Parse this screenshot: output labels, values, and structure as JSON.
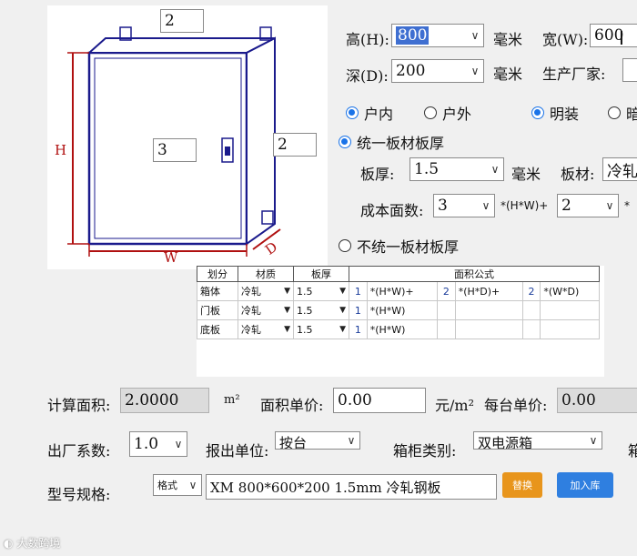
{
  "drawing": {
    "top_value": "2",
    "front_value": "3",
    "side_value": "2",
    "label_h": "H",
    "label_w": "W",
    "label_d": "D"
  },
  "dimensions": {
    "height_label": "高(H):",
    "height_value": "800",
    "height_unit": "毫米",
    "width_label": "宽(W):",
    "width_value": "600",
    "depth_label": "深(D):",
    "depth_value": "200",
    "depth_unit": "毫米",
    "manufacturer_label": "生产厂家:"
  },
  "options": {
    "indoor": "户内",
    "outdoor": "户外",
    "surface": "明装",
    "flush": "暗",
    "uniform": "统一板材板厚",
    "non_uniform": "不统一板材板厚",
    "indoor_selected": true,
    "surface_selected": true,
    "uniform_selected": true
  },
  "uniform": {
    "thickness_label": "板厚:",
    "thickness_value": "1.5",
    "thickness_unit": "毫米",
    "material_label": "板材:",
    "material_value": "冷轧",
    "cost_label": "成本面数:",
    "cost_a": "3",
    "cost_op1": "*(H*W)+",
    "cost_b": "2",
    "cost_op2": "*"
  },
  "table": {
    "headers": [
      "划分",
      "材质",
      "板厚",
      "面积公式"
    ],
    "rows": [
      {
        "part": "箱体",
        "material": "冷轧",
        "thickness": "1.5",
        "c1": "1",
        "f1": "*(H*W)+",
        "c2": "2",
        "f2": "*(H*D)+",
        "c3": "2",
        "f3": "*(W*D)"
      },
      {
        "part": "门板",
        "material": "冷轧",
        "thickness": "1.5",
        "c1": "1",
        "f1": "*(H*W)",
        "c2": "",
        "f2": "",
        "c3": "",
        "f3": ""
      },
      {
        "part": "底板",
        "material": "冷轧",
        "thickness": "1.5",
        "c1": "1",
        "f1": "*(H*W)",
        "c2": "",
        "f2": "",
        "c3": "",
        "f3": ""
      }
    ]
  },
  "calc": {
    "area_label": "计算面积:",
    "area_value": "2.0000",
    "area_unit": "m²",
    "unit_price_label": "面积单价:",
    "unit_price_value": "0.00",
    "unit_price_unit": "元/m²",
    "each_price_label": "每台单价:",
    "each_price_value": "0.00",
    "factor_label": "出厂系数:",
    "factor_value": "1.0",
    "report_unit_label": "报出单位:",
    "report_unit_value": "按台",
    "cabinet_type_label": "箱柜类别:",
    "cabinet_type_value": "双电源箱",
    "cabinet_type_extra": "箱",
    "model_label": "型号规格:",
    "format_value": "格式",
    "model_value": "XM 800*600*200 1.5mm 冷轧钢板",
    "replace_button": "替换",
    "add_button": "加入库"
  },
  "watermark": "大数跨境",
  "colors": {
    "accent": "#1a73e8",
    "replace": "#e8951c",
    "add": "#2f7fe0",
    "drawing": "#1a1a8c",
    "dim": "#b01010"
  }
}
